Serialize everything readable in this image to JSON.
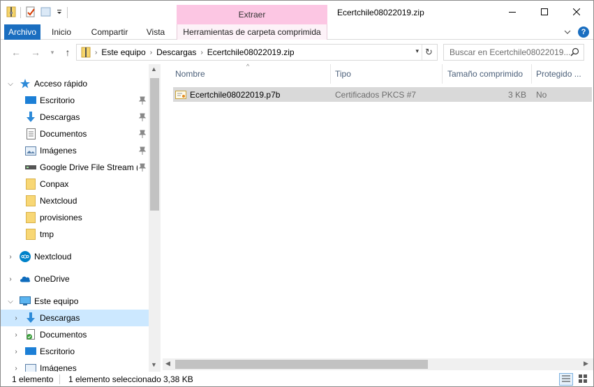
{
  "window": {
    "title": "Ecertchile08022019.zip",
    "context_tab_group": "Extraer"
  },
  "ribbon": {
    "tabs": [
      "Archivo",
      "Inicio",
      "Compartir",
      "Vista",
      "Herramientas de carpeta comprimida"
    ]
  },
  "address": {
    "crumbs": [
      "Este equipo",
      "Descargas",
      "Ecertchile08022019.zip"
    ],
    "search_placeholder": "Buscar en Ecertchile08022019...."
  },
  "nav": {
    "quick_access": "Acceso rápido",
    "quick_items": [
      "Escritorio",
      "Descargas",
      "Documentos",
      "Imágenes",
      "Google Drive File Stream (G:",
      "Conpax",
      "Nextcloud",
      "provisiones",
      "tmp"
    ],
    "nextcloud": "Nextcloud",
    "onedrive": "OneDrive",
    "this_pc": "Este equipo",
    "pc_items": [
      "Descargas",
      "Documentos",
      "Escritorio",
      "Imágenes"
    ]
  },
  "file_list": {
    "columns": [
      "Nombre",
      "Tipo",
      "Tamaño comprimido",
      "Protegido ..."
    ],
    "rows": [
      {
        "name": "Ecertchile08022019.p7b",
        "type": "Certificados PKCS #7",
        "size": "3 KB",
        "protected": "No"
      }
    ]
  },
  "status": {
    "count": "1 elemento",
    "selected": "1 elemento seleccionado",
    "size": "3,38 KB"
  },
  "colors": {
    "file_tab": "#1a6ec0",
    "context_tab": "#fcc6e3",
    "selection": "#cce8ff",
    "row_selected": "#d9d9d9"
  }
}
